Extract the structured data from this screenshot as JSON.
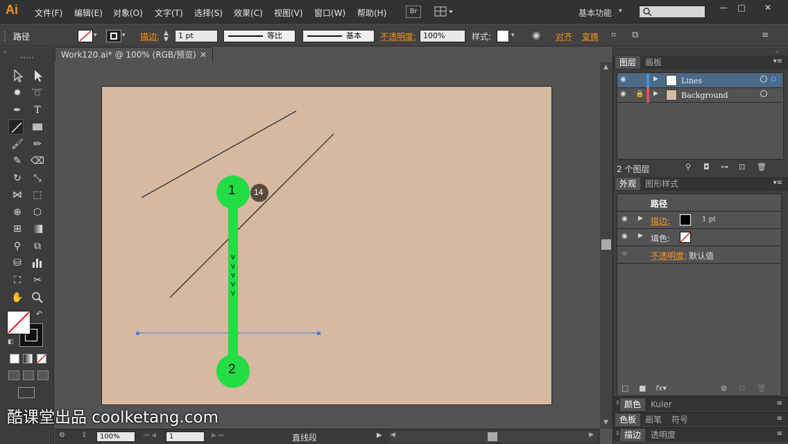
{
  "menubar": {
    "logo": "Ai",
    "items": [
      "文件(F)",
      "编辑(E)",
      "对象(O)",
      "文字(T)",
      "选择(S)",
      "效果(C)",
      "视图(V)",
      "窗口(W)",
      "帮助(H)"
    ],
    "br": "Br",
    "workspace": "基本功能",
    "window_controls": [
      "—",
      "□",
      "✕"
    ]
  },
  "control": {
    "selection_label": "路径",
    "stroke_label": "描边:",
    "stroke_weight": "1 pt",
    "profile_label": "等比",
    "brush_label": "基本",
    "opacity_label": "不透明度:",
    "opacity_value": "100%",
    "style_label": "样式:",
    "align_label": "对齐",
    "transform_label": "变换"
  },
  "document": {
    "tab_title": "Work120.ai* @ 100% (RGB/预览)"
  },
  "annotations": {
    "start_num": "1",
    "end_num": "2",
    "step_num": "14",
    "arrows": [
      "v",
      "v",
      "v",
      "v",
      "v"
    ]
  },
  "status": {
    "zoom": "100%",
    "artboard": "1",
    "tool_name": "直线段"
  },
  "layers_panel": {
    "tabs": [
      "图层",
      "画板"
    ],
    "layers": [
      {
        "name": "Lines",
        "color": "#4a90e2",
        "swatch": "#ffffff"
      },
      {
        "name": "Background",
        "color": "#e05050",
        "swatch": "#d5b9a1"
      }
    ],
    "count_label": "2 个图层"
  },
  "appearance_panel": {
    "tabs": [
      "外观",
      "图形样式"
    ],
    "header": "路径",
    "stroke_label": "描边:",
    "stroke_value": "1 pt",
    "fill_label": "填色:",
    "opacity_label": "不透明度:",
    "opacity_value": "默认值"
  },
  "collapsed_panels": [
    {
      "tabs": [
        "颜色",
        "Kuler"
      ]
    },
    {
      "tabs": [
        "色板",
        "画笔",
        "符号"
      ]
    },
    {
      "tabs": [
        "描边",
        "透明度"
      ]
    }
  ],
  "watermark": "酷课堂出品 coolketang.com",
  "colors": {
    "accent_orange": "#f7941d",
    "annotation_green": "#22dd44",
    "artboard_bg": "#d5b9a1",
    "selection_blue": "#4a7fe0"
  }
}
